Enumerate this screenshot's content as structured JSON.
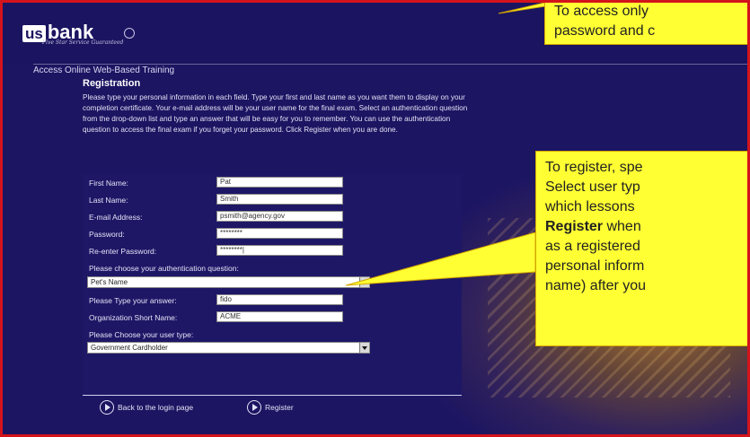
{
  "header": {
    "logo_us": "us",
    "logo_bank": "bank",
    "logo_tagline": "Five Star Service Guaranteed",
    "breadcrumb": "Access Online Web-Based Training"
  },
  "registration": {
    "title": "Registration",
    "intro": "Please type your personal information in each field. Type your first and last name as you want them to display on your completion certificate. Your e-mail address will be your user name for the final exam. Select an authentication question from the drop-down list and type an answer that will be easy for you to remember. You can use the authentication question to access the final exam if you forget your password. Click Register when you are done.",
    "fields": {
      "first_name": {
        "label": "First Name:",
        "value": "Pat"
      },
      "last_name": {
        "label": "Last Name:",
        "value": "Smith"
      },
      "email": {
        "label": "E-mail Address:",
        "value": "psmith@agency.gov"
      },
      "password": {
        "label": "Password:",
        "value": "********"
      },
      "reenter_password": {
        "label": "Re-enter Password:",
        "value": "********|"
      },
      "auth_question_prompt": "Please choose your authentication question:",
      "auth_question_value": "Pet's Name",
      "answer": {
        "label": "Please Type your answer:",
        "value": "fido"
      },
      "org": {
        "label": "Organization Short Name:",
        "value": "ACME"
      },
      "user_type_prompt": "Please Choose your user type:",
      "user_type_value": "Government Cardholder"
    },
    "buttons": {
      "back": "Back to the login page",
      "register": "Register"
    }
  },
  "callouts": {
    "top": {
      "line1": "To access only",
      "line2": "password and c"
    },
    "mid": {
      "line1": "To register, spe",
      "line2": "Select user typ",
      "line3": "which lessons",
      "line4_bold": "Register",
      "line4_rest": " when",
      "line5": "as a registered",
      "line6": "personal inform",
      "line7": "name) after you"
    }
  },
  "colors": {
    "page_bg": "#1c1562",
    "frame_border": "#d4141c",
    "callout_bg": "#ffff33"
  }
}
